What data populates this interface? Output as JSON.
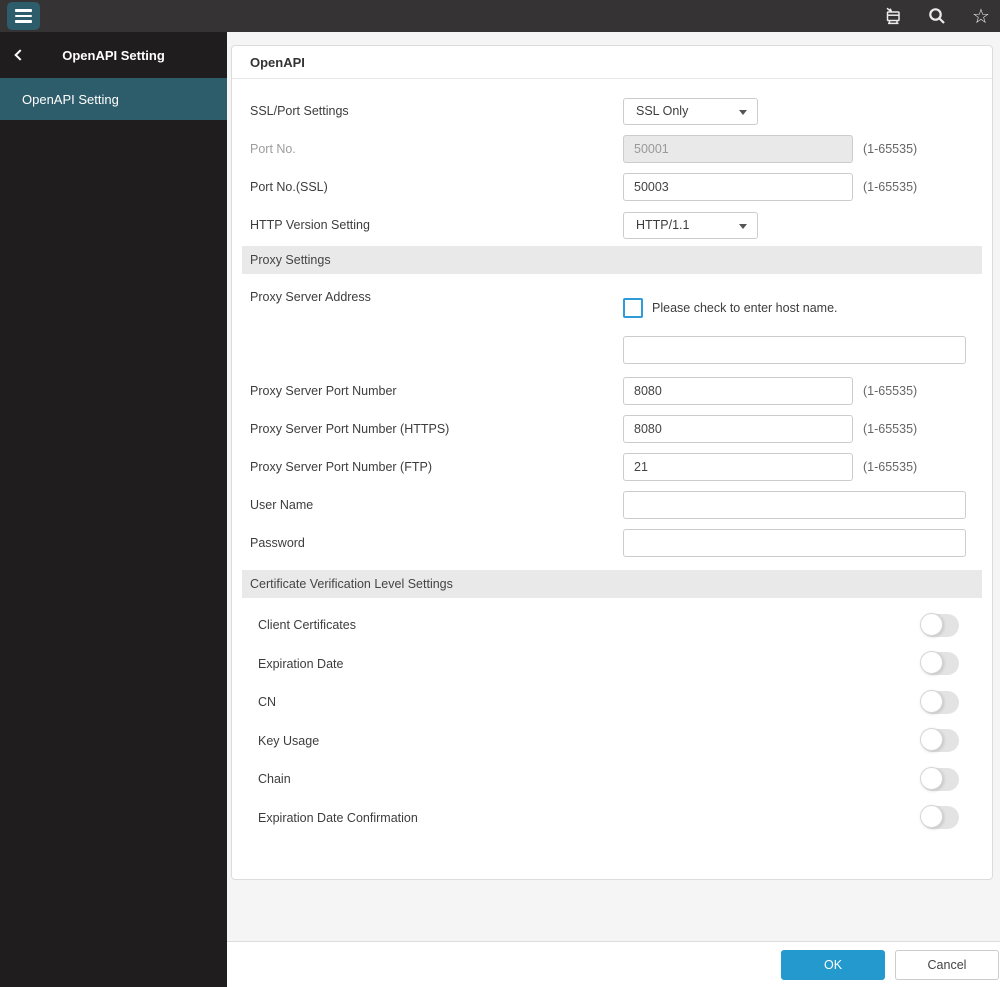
{
  "topbar": {
    "star_glyph": "☆",
    "icons": [
      "menu-hamburger",
      "printer-device",
      "search-magnifier",
      "favorite-star"
    ]
  },
  "sidebar": {
    "title": "OpenAPI Setting",
    "items": [
      {
        "label": "OpenAPI Setting",
        "selected": true
      }
    ]
  },
  "form": {
    "title": "OpenAPI",
    "openapi": {
      "ssl_port": {
        "label": "SSL/Port Settings",
        "value": "SSL Only"
      },
      "port": {
        "label": "Port No.",
        "value": "50001",
        "hint": "(1-65535)",
        "disabled": true
      },
      "port_ssl": {
        "label": "Port No.(SSL)",
        "value": "50003",
        "hint": "(1-65535)"
      },
      "http_version": {
        "label": "HTTP Version Setting",
        "value": "HTTP/1.1"
      }
    },
    "proxy": {
      "header": "Proxy Settings",
      "address_label": "Proxy Server Address",
      "checkbox_label": "Please check to enter host name.",
      "checkbox_checked": false,
      "host_value": "",
      "port": {
        "label": "Proxy Server Port Number",
        "value": "8080",
        "hint": "(1-65535)"
      },
      "port_https": {
        "label": "Proxy Server Port Number (HTTPS)",
        "value": "8080",
        "hint": "(1-65535)"
      },
      "port_ftp": {
        "label": "Proxy Server Port Number (FTP)",
        "value": "21",
        "hint": "(1-65535)"
      },
      "user": {
        "label": "User Name",
        "value": ""
      },
      "password": {
        "label": "Password",
        "value": ""
      }
    },
    "cert": {
      "header": "Certificate Verification Level Settings",
      "toggles": [
        {
          "label": "Client Certificates",
          "on": false
        },
        {
          "label": "Expiration Date",
          "on": false
        },
        {
          "label": "CN",
          "on": false
        },
        {
          "label": "Key Usage",
          "on": false
        },
        {
          "label": "Chain",
          "on": false
        },
        {
          "label": "Expiration Date Confirmation",
          "on": false
        }
      ]
    }
  },
  "footer": {
    "ok": "OK",
    "cancel": "Cancel"
  },
  "colors": {
    "accent_teal": "#2d5c6b",
    "accent_blue": "#2499ce",
    "checkbox_blue": "#2e9cd6",
    "topbar_bg": "#353334",
    "sidebar_bg": "#1f1d1e",
    "section_header_bg": "#e9e9e9"
  }
}
